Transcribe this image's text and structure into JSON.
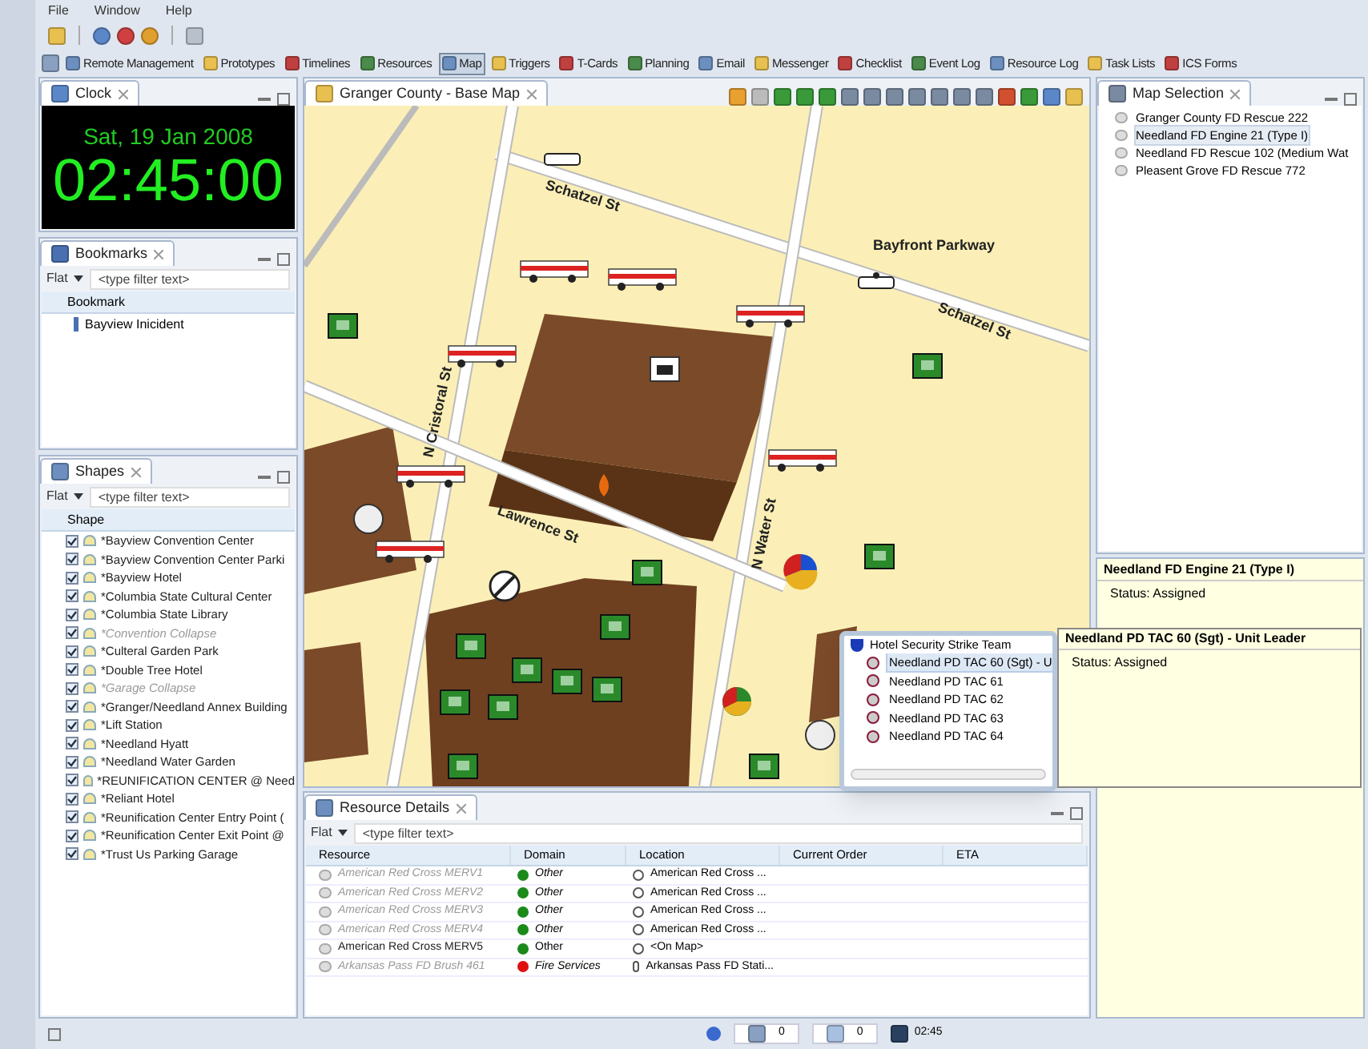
{
  "menu": [
    "File",
    "Window",
    "Help"
  ],
  "perspectives": [
    {
      "label": "Remote Management",
      "selected": false
    },
    {
      "label": "Prototypes",
      "selected": false
    },
    {
      "label": "Timelines",
      "selected": false
    },
    {
      "label": "Resources",
      "selected": false
    },
    {
      "label": "Map",
      "selected": true
    },
    {
      "label": "Triggers",
      "selected": false
    },
    {
      "label": "T-Cards",
      "selected": false
    },
    {
      "label": "Planning",
      "selected": false
    },
    {
      "label": "Email",
      "selected": false
    },
    {
      "label": "Messenger",
      "selected": false
    },
    {
      "label": "Checklist",
      "selected": false
    },
    {
      "label": "Event Log",
      "selected": false
    },
    {
      "label": "Resource Log",
      "selected": false
    },
    {
      "label": "Task Lists",
      "selected": false
    },
    {
      "label": "ICS Forms",
      "selected": false
    }
  ],
  "clock": {
    "title": "Clock",
    "date": "Sat, 19 Jan 2008",
    "time": "02:45:00"
  },
  "bookmarks": {
    "title": "Bookmarks",
    "mode": "Flat",
    "placeholder": "<type filter text>",
    "column": "Bookmark",
    "items": [
      "Bayview Inicident"
    ]
  },
  "shapes": {
    "title": "Shapes",
    "mode": "Flat",
    "placeholder": "<type filter text>",
    "column": "Shape",
    "items": [
      {
        "label": "*Bayview Convention Center",
        "checked": true,
        "dimmed": false
      },
      {
        "label": "*Bayview Convention Center Parki",
        "checked": true,
        "dimmed": false
      },
      {
        "label": "*Bayview Hotel",
        "checked": true,
        "dimmed": false
      },
      {
        "label": "*Columbia State Cultural Center",
        "checked": true,
        "dimmed": false
      },
      {
        "label": "*Columbia State Library",
        "checked": true,
        "dimmed": false
      },
      {
        "label": "*Convention Collapse",
        "checked": true,
        "dimmed": true
      },
      {
        "label": "*Culteral Garden Park",
        "checked": true,
        "dimmed": false
      },
      {
        "label": "*Double Tree Hotel",
        "checked": true,
        "dimmed": false
      },
      {
        "label": "*Garage Collapse",
        "checked": true,
        "dimmed": true
      },
      {
        "label": "*Granger/Needland Annex Building",
        "checked": true,
        "dimmed": false
      },
      {
        "label": "*Lift Station",
        "checked": true,
        "dimmed": false
      },
      {
        "label": "*Needland Hyatt",
        "checked": true,
        "dimmed": false
      },
      {
        "label": "*Needland Water Garden",
        "checked": true,
        "dimmed": false
      },
      {
        "label": "*REUNIFICATION CENTER @ Need",
        "checked": true,
        "dimmed": false
      },
      {
        "label": "*Reliant Hotel",
        "checked": true,
        "dimmed": false
      },
      {
        "label": "*Reunification Center Entry Point (",
        "checked": true,
        "dimmed": false
      },
      {
        "label": "*Reunification Center Exit Point @",
        "checked": true,
        "dimmed": false
      },
      {
        "label": "*Trust Us Parking Garage",
        "checked": true,
        "dimmed": false
      }
    ]
  },
  "map": {
    "title": "Granger County - Base Map",
    "streets": [
      "Schatzel St",
      "Bayfront Parkway",
      "Schatzel St",
      "N Cristoral St",
      "Lawrence St",
      "N Water St"
    ],
    "popup": {
      "team": "Hotel Security Strike Team",
      "members": [
        {
          "label": "Needland PD TAC 60 (Sgt) - U",
          "selected": true
        },
        {
          "label": "Needland PD TAC 61",
          "selected": false
        },
        {
          "label": "Needland PD TAC 62",
          "selected": false
        },
        {
          "label": "Needland PD TAC 63",
          "selected": false
        },
        {
          "label": "Needland PD TAC 64",
          "selected": false
        }
      ]
    },
    "tooltip": {
      "title": "Needland PD TAC 60 (Sgt) - Unit Leader",
      "status": "Status: Assigned"
    }
  },
  "map_selection": {
    "title": "Map Selection",
    "items": [
      {
        "label": "Granger County FD Rescue 222",
        "selected": false
      },
      {
        "label": "Needland FD Engine 21 (Type I)",
        "selected": true
      },
      {
        "label": "Needland FD Rescue 102 (Medium Wat",
        "selected": false
      },
      {
        "label": "Pleasent Grove FD Rescue 772",
        "selected": false
      }
    ]
  },
  "details": {
    "title": "Needland FD Engine 21 (Type I)",
    "status": "Status: Assigned"
  },
  "resource_details": {
    "title": "Resource Details",
    "mode": "Flat",
    "placeholder": "<type filter text>",
    "columns": [
      "Resource",
      "Domain",
      "Location",
      "Current Order",
      "ETA"
    ],
    "rows": [
      {
        "resource": "American Red Cross MERV1",
        "domain": "Other",
        "color": "#1a8a1a",
        "location": "American Red Cross ...",
        "dimmed": true
      },
      {
        "resource": "American Red Cross MERV2",
        "domain": "Other",
        "color": "#1a8a1a",
        "location": "American Red Cross ...",
        "dimmed": true
      },
      {
        "resource": "American Red Cross MERV3",
        "domain": "Other",
        "color": "#1a8a1a",
        "location": "American Red Cross ...",
        "dimmed": true
      },
      {
        "resource": "American Red Cross MERV4",
        "domain": "Other",
        "color": "#1a8a1a",
        "location": "American Red Cross ...",
        "dimmed": true
      },
      {
        "resource": "American Red Cross MERV5",
        "domain": "Other",
        "color": "#1a8a1a",
        "location": "<On Map>",
        "dimmed": false
      },
      {
        "resource": "Arkansas Pass FD Brush 461",
        "domain": "Fire Services",
        "color": "#e01010",
        "location": "Arkansas Pass FD Stati...",
        "dimmed": true
      }
    ]
  },
  "status_bar": {
    "tasks": "0",
    "messages": "0",
    "time": "02:45"
  }
}
